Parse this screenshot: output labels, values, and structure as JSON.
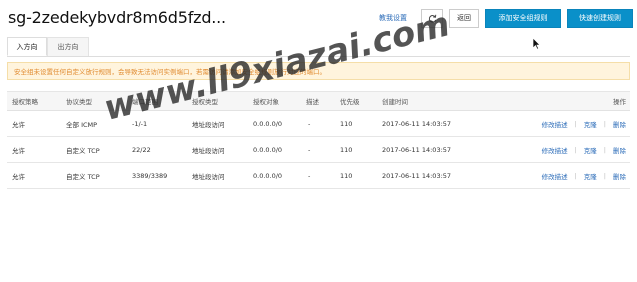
{
  "page": {
    "title": "sg-2zedekybvdr8m6d5fzd..."
  },
  "toolbar": {
    "help_link": "教我设置",
    "back_label": "返回",
    "add_rule_label": "添加安全组规则",
    "quick_create_label": "快速创建规则",
    "refresh_icon": "refresh-icon"
  },
  "tabs": [
    {
      "label": "入方向",
      "active": true
    },
    {
      "label": "出方向",
      "active": false
    }
  ],
  "notice": {
    "text": "安全组未设置任何自定义放行规则，会导致无法访问实例端口，若需访问请添加安全组规则放行对应的端口。"
  },
  "table": {
    "headers": {
      "policy": "授权策略",
      "protocol": "协议类型",
      "port_range": "端口范围",
      "auth_type": "授权类型",
      "auth_object": "授权对象",
      "description": "描述",
      "priority": "优先级",
      "created_at": "创建时间",
      "operation": "操作"
    },
    "rows": [
      {
        "policy": "允许",
        "protocol": "全部 ICMP",
        "port_range": "-1/-1",
        "auth_type": "地址段访问",
        "auth_object": "0.0.0.0/0",
        "description": "-",
        "priority": "110",
        "created_at": "2017-06-11 14:03:57",
        "act_edit": "修改描述",
        "act_clone": "克隆",
        "act_delete": "删除"
      },
      {
        "policy": "允许",
        "protocol": "自定义 TCP",
        "port_range": "22/22",
        "auth_type": "地址段访问",
        "auth_object": "0.0.0.0/0",
        "description": "-",
        "priority": "110",
        "created_at": "2017-06-11 14:03:57",
        "act_edit": "修改描述",
        "act_clone": "克隆",
        "act_delete": "删除"
      },
      {
        "policy": "允许",
        "protocol": "自定义 TCP",
        "port_range": "3389/3389",
        "auth_type": "地址段访问",
        "auth_object": "0.0.0.0/0",
        "description": "-",
        "priority": "110",
        "created_at": "2017-06-11 14:03:57",
        "act_edit": "修改描述",
        "act_clone": "克隆",
        "act_delete": "删除"
      }
    ]
  },
  "watermark": {
    "text": "www.ll9xiazai.com"
  },
  "colors": {
    "primary": "#0a90c9",
    "link": "#2a6bb8",
    "notice_bg": "#fff4dd",
    "notice_text": "#e08a2f"
  }
}
